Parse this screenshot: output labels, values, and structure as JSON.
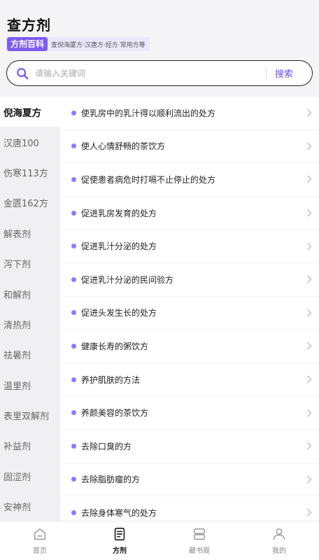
{
  "header": {
    "title": "查方剂",
    "badge": "方剂百科",
    "badge_desc": "查倪海厦方·汉唐方·经方·常用方等"
  },
  "search": {
    "placeholder": "请输入关键词",
    "button": "搜索",
    "icon": "search-icon"
  },
  "sidebar": {
    "items": [
      {
        "label": "倪海夏方",
        "active": true
      },
      {
        "label": "汉唐100"
      },
      {
        "label": "伤寒113方"
      },
      {
        "label": "金匮162方"
      },
      {
        "label": "解表剂"
      },
      {
        "label": "泻下剂"
      },
      {
        "label": "和解剂"
      },
      {
        "label": "清热剂"
      },
      {
        "label": "祛暑剂"
      },
      {
        "label": "温里剂"
      },
      {
        "label": "表里双解剂"
      },
      {
        "label": "补益剂"
      },
      {
        "label": "固涩剂"
      },
      {
        "label": "安神剂"
      }
    ]
  },
  "list": {
    "items": [
      "使乳房中的乳汁得以顺利流出的处方",
      "使人心情舒畅的茶饮方",
      "促使患者病危时打嗝不止停止的处方",
      "促进乳房发育的处方",
      "促进乳汁分泌的处方",
      "促进乳汁分泌的民间验方",
      "促进头发生长的处方",
      "健康长寿的粥饮方",
      "养护肌肤的方法",
      "养颜美容的茶饮方",
      "去除口臭的方",
      "去除脂肪瘤的方",
      "去除身体寒气的处方"
    ]
  },
  "tabbar": {
    "tabs": [
      {
        "label": "首页",
        "icon": "home-icon"
      },
      {
        "label": "方剂",
        "icon": "document-icon",
        "active": true
      },
      {
        "label": "藏书阁",
        "icon": "bookshelf-icon"
      },
      {
        "label": "我的",
        "icon": "user-icon"
      }
    ]
  },
  "colors": {
    "accent": "#7a5cf0",
    "dot": "#8d7cf2"
  }
}
